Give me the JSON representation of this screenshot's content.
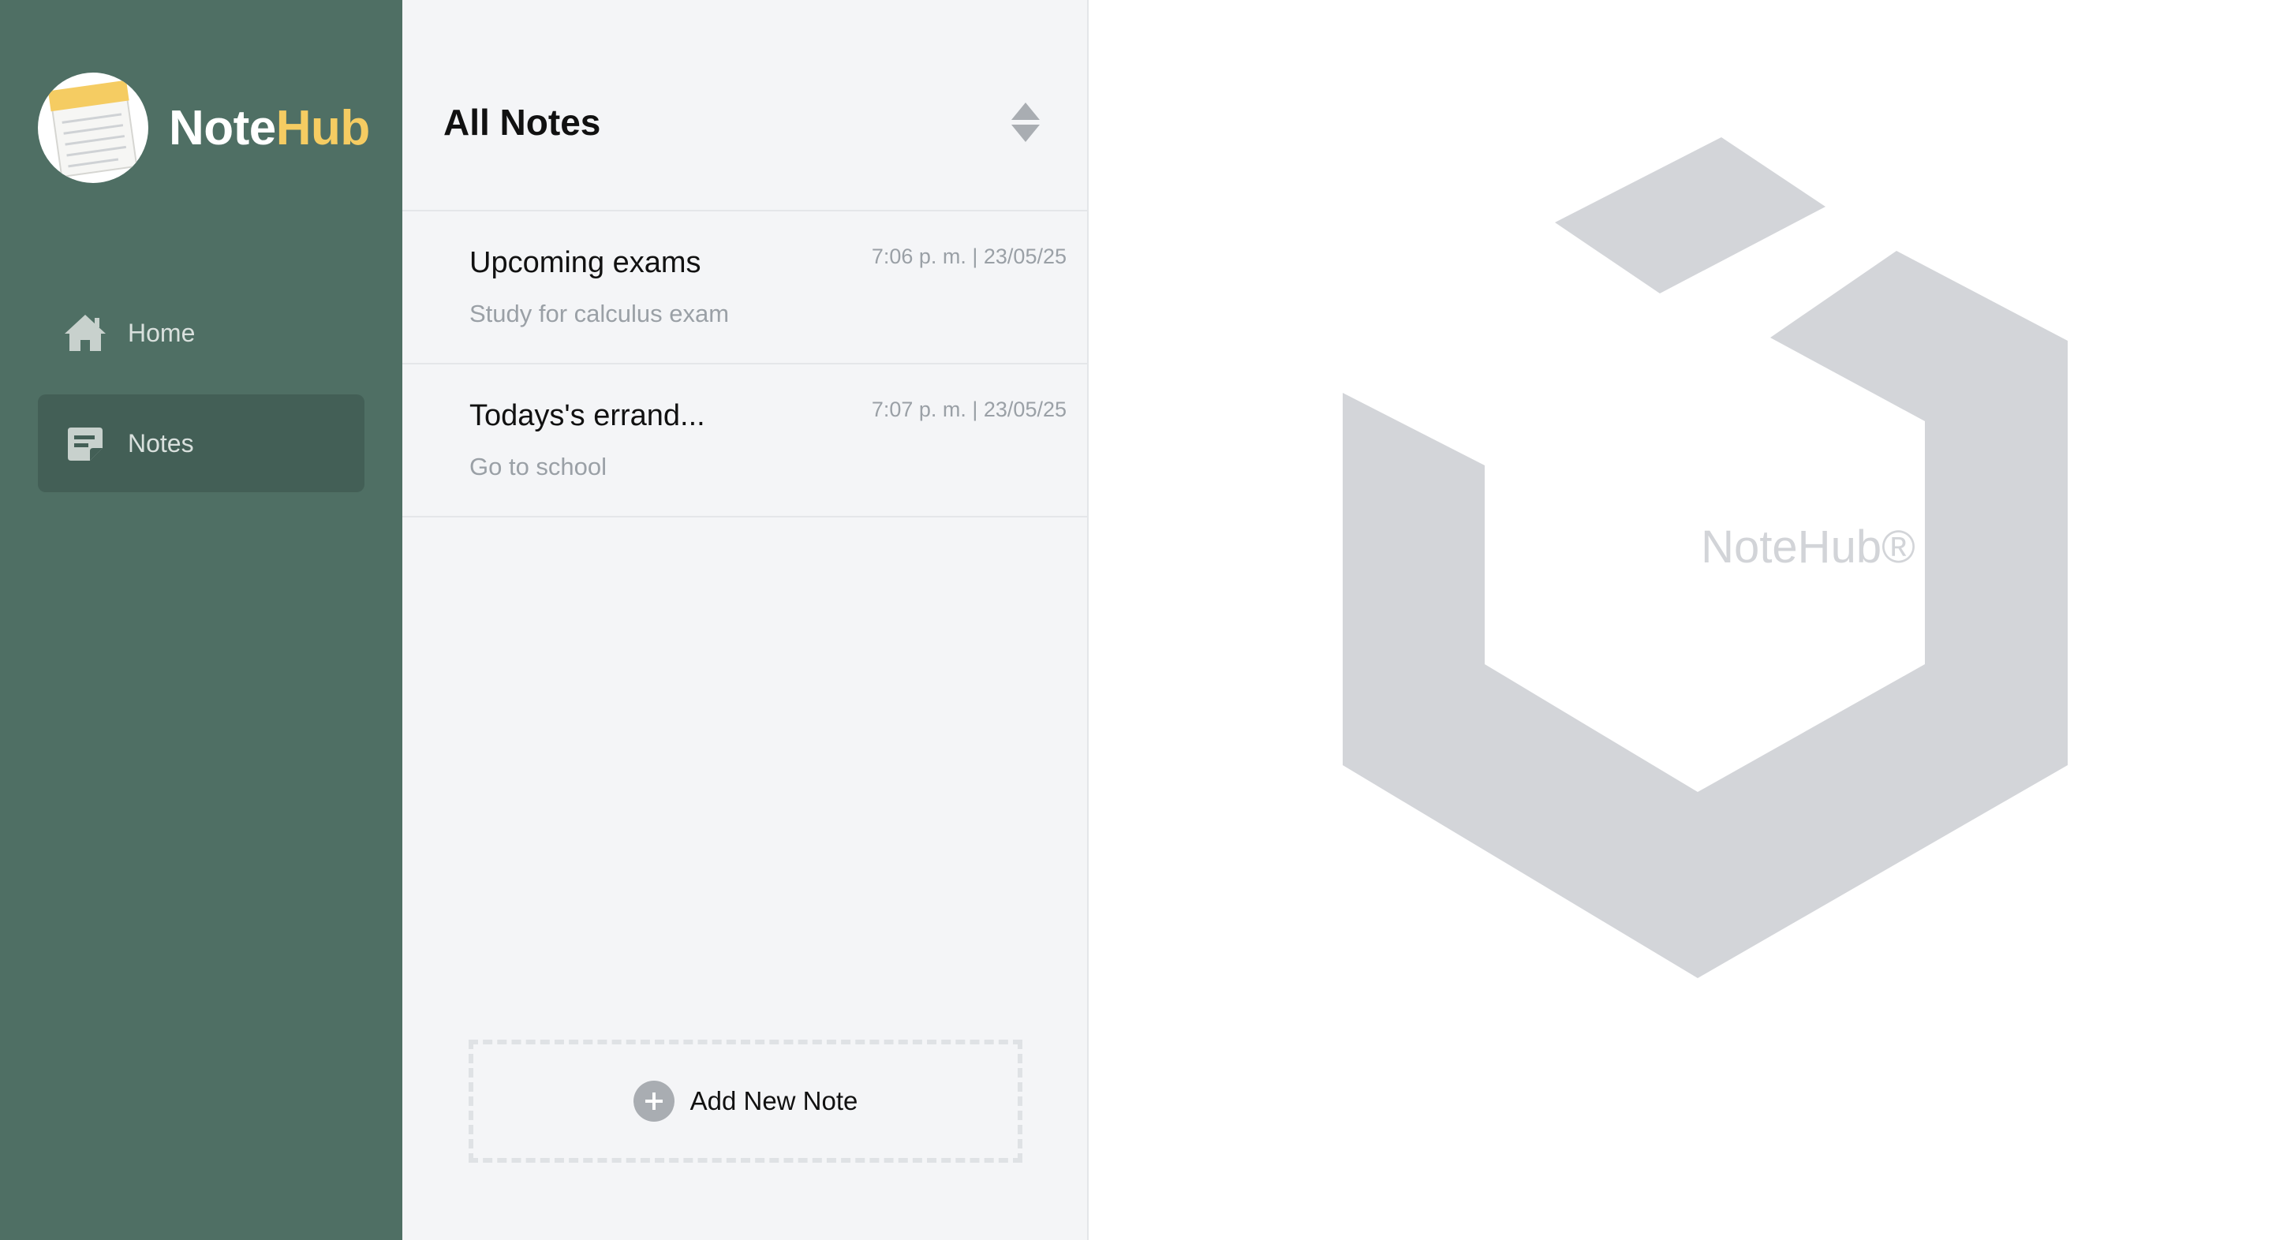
{
  "brand": {
    "name_part1": "Note",
    "name_part2": "Hub",
    "accent_color": "#f5cc62",
    "logo_icon": "notepad-icon"
  },
  "sidebar": {
    "background": "#4f6f64",
    "items": [
      {
        "label": "Home",
        "icon": "home-icon",
        "active": false
      },
      {
        "label": "Notes",
        "icon": "notes-icon",
        "active": true
      }
    ]
  },
  "list": {
    "title": "All Notes",
    "sort_icon": "sort-icon",
    "notes": [
      {
        "title": "Upcoming exams",
        "time": "7:06 p. m. | 23/05/25",
        "preview": "Study for calculus exam"
      },
      {
        "title": "Todays's errand...",
        "time": "7:07 p. m. | 23/05/25",
        "preview": "Go to school"
      }
    ],
    "add_label": "Add New Note",
    "add_icon": "plus-icon"
  },
  "empty_state": {
    "watermark": "NoteHub®",
    "graphic": "hexagon-logo-graphic"
  }
}
